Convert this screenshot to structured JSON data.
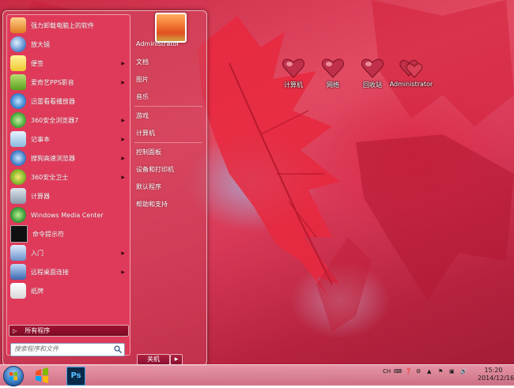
{
  "desktop": {
    "icons": [
      {
        "label": "计算机"
      },
      {
        "label": "网络"
      },
      {
        "label": "回收站"
      },
      {
        "label": "Administrator"
      }
    ]
  },
  "start_menu": {
    "programs": [
      {
        "label": "强力卸载电脑上的软件",
        "icon": "uninstall-icon",
        "arrow": false
      },
      {
        "label": "放大镜",
        "icon": "magnifier-icon",
        "arrow": false
      },
      {
        "label": "便签",
        "icon": "sticky-notes-icon",
        "arrow": true
      },
      {
        "label": "爱奇艺PPS影音",
        "icon": "pps-icon",
        "arrow": true
      },
      {
        "label": "迅雷看看播放器",
        "icon": "xunlei-icon",
        "arrow": false
      },
      {
        "label": "360安全浏览器7",
        "icon": "360-browser-icon",
        "arrow": true
      },
      {
        "label": "记事本",
        "icon": "notepad-icon",
        "arrow": true
      },
      {
        "label": "搜狗高速浏览器",
        "icon": "sogou-browser-icon",
        "arrow": true
      },
      {
        "label": "360安全卫士",
        "icon": "360-security-icon",
        "arrow": true
      },
      {
        "label": "计算器",
        "icon": "calculator-icon",
        "arrow": false
      },
      {
        "label": "Windows Media Center",
        "icon": "media-center-icon",
        "arrow": false
      },
      {
        "label": "命令提示符",
        "icon": "cmd-icon",
        "arrow": false
      },
      {
        "label": "入门",
        "icon": "getting-started-icon",
        "arrow": true
      },
      {
        "label": "远程桌面连接",
        "icon": "remote-desktop-icon",
        "arrow": true
      },
      {
        "label": "纸牌",
        "icon": "solitaire-icon",
        "arrow": false
      }
    ],
    "all_programs": "所有程序",
    "search_placeholder": "搜索程序和文件",
    "right_items": [
      {
        "label": "Administrator"
      },
      {
        "label": "文档"
      },
      {
        "label": "图片"
      },
      {
        "label": "音乐"
      },
      {
        "label": "游戏"
      },
      {
        "label": "计算机"
      },
      {
        "label": "控制面板"
      },
      {
        "label": "设备和打印机"
      },
      {
        "label": "默认程序"
      },
      {
        "label": "帮助和支持"
      }
    ],
    "shutdown_label": "关机"
  },
  "taskbar": {
    "pinned": [
      {
        "name": "start-orb"
      },
      {
        "name": "windows-explorer-icon"
      },
      {
        "name": "photoshop-icon",
        "text": "Ps"
      }
    ],
    "tray": {
      "lang": "CH",
      "time": "15:20",
      "date": "2014/12/16"
    }
  }
}
